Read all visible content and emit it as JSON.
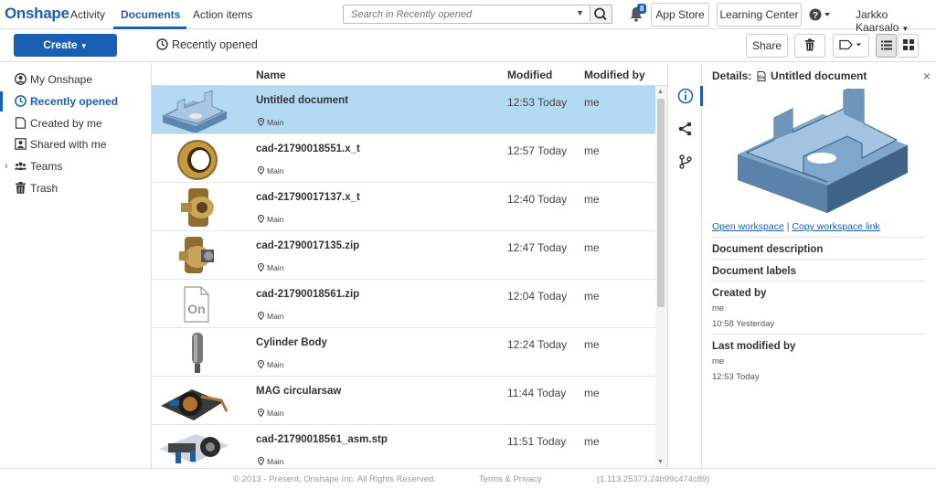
{
  "topbar": {
    "logo": "Onshape",
    "nav": [
      "Activity",
      "Documents",
      "Action items"
    ],
    "search_placeholder": "Search in Recently opened",
    "notification_count": "8",
    "app_store": "App Store",
    "learning_center": "Learning Center",
    "user_name": "Jarkko Kaarsalo"
  },
  "toolbar": {
    "create_label": "Create",
    "breadcrumb": "Recently opened",
    "share_label": "Share"
  },
  "sidebar": {
    "items": [
      {
        "label": "My Onshape",
        "icon": "user-circle-icon"
      },
      {
        "label": "Recently opened",
        "icon": "clock-icon"
      },
      {
        "label": "Created by me",
        "icon": "document-icon"
      },
      {
        "label": "Shared with me",
        "icon": "shared-user-icon"
      },
      {
        "label": "Teams",
        "icon": "team-icon"
      },
      {
        "label": "Trash",
        "icon": "trash-icon"
      }
    ]
  },
  "table": {
    "columns": [
      "Name",
      "Modified",
      "Modified by"
    ],
    "rows": [
      {
        "name": "Untitled document",
        "branch": "Main",
        "modified": "12:53 Today",
        "by": "me",
        "thumb": "bracket"
      },
      {
        "name": "cad-21790018551.x_t",
        "branch": "Main",
        "modified": "12:57 Today",
        "by": "me",
        "thumb": "ring"
      },
      {
        "name": "cad-21790017137.x_t",
        "branch": "Main",
        "modified": "12:40 Today",
        "by": "me",
        "thumb": "flange"
      },
      {
        "name": "cad-21790017135.zip",
        "branch": "Main",
        "modified": "12:47 Today",
        "by": "me",
        "thumb": "flange2"
      },
      {
        "name": "cad-21790018561.zip",
        "branch": "Main",
        "modified": "12:04 Today",
        "by": "me",
        "thumb": "onshape-file"
      },
      {
        "name": "Cylinder Body",
        "branch": "Main",
        "modified": "12:24 Today",
        "by": "me",
        "thumb": "cylinder"
      },
      {
        "name": "MAG circularsaw",
        "branch": "Main",
        "modified": "11:44 Today",
        "by": "me",
        "thumb": "saw"
      },
      {
        "name": "cad-21790018561_asm.stp",
        "branch": "Main",
        "modified": "11:51 Today",
        "by": "me",
        "thumb": "assembly"
      }
    ]
  },
  "details": {
    "title_prefix": "Details:",
    "title": "Untitled document",
    "open_workspace": "Open workspace",
    "separator": "|",
    "copy_link": "Copy workspace link",
    "description_label": "Document description",
    "labels_label": "Document labels",
    "created_by_label": "Created by",
    "created_by": "me",
    "created_time": "10:58 Yesterday",
    "modified_by_label": "Last modified by",
    "modified_by": "me",
    "modified_time": "12:53 Today"
  },
  "footer": {
    "copyright": "© 2013 - Present, Onshape Inc. All Rights Reserved.",
    "terms": "Terms & Privacy",
    "version": "(1.113.25373.24b99c474c89)"
  },
  "colors": {
    "accent": "#1a5fb4",
    "selected_row": "#b3daf2"
  }
}
